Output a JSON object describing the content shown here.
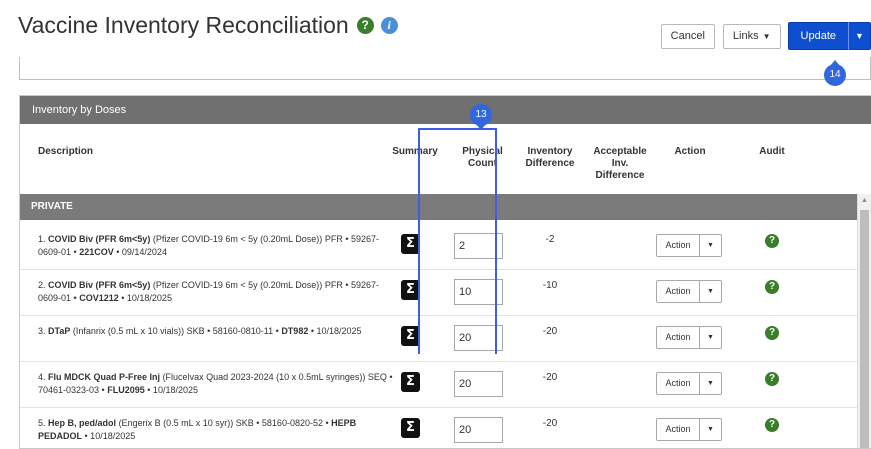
{
  "header": {
    "title": "Vaccine Inventory Reconciliation",
    "help_glyph": "?",
    "info_glyph": "i",
    "buttons": {
      "cancel": "Cancel",
      "links": "Links",
      "update": "Update"
    },
    "accent_color": "#0d4fcf"
  },
  "callouts": {
    "physical_count": "13",
    "update": "14"
  },
  "panel": {
    "title": "Inventory by Doses",
    "columns": {
      "description": "Description",
      "summary": "Summary",
      "physical_count_1": "Physical",
      "physical_count_2": "Count",
      "inventory_difference_1": "Inventory",
      "inventory_difference_2": "Difference",
      "acceptable_1": "Acceptable",
      "acceptable_2": "Inv.",
      "acceptable_3": "Difference",
      "action": "Action",
      "audit": "Audit"
    },
    "section": "PRIVATE",
    "summary_glyph": "Σ",
    "action_label": "Action",
    "audit_glyph": "?"
  },
  "rows": [
    {
      "num": "1.",
      "name": "COVID Biv (PFR 6m<5y)",
      "detail": "(Pfizer COVID-19 6m < 5y (0.20mL Dose))",
      "meta": "PFR • 59267-0609-01 •",
      "lot": "221COV",
      "date": "• 09/14/2024",
      "count": "2",
      "difference": "-2"
    },
    {
      "num": "2.",
      "name": "COVID Biv (PFR 6m<5y)",
      "detail": "(Pfizer COVID-19 6m < 5y (0.20mL Dose))",
      "meta": "PFR • 59267-0609-01 •",
      "lot": "COV1212",
      "date": "• 10/18/2025",
      "count": "10",
      "difference": "-10"
    },
    {
      "num": "3.",
      "name": "DTaP",
      "detail": "(Infanrix (0.5 mL x 10 vials)) SKB • 58160-0810-11 •",
      "meta": "",
      "lot": "DT982",
      "date": "• 10/18/2025",
      "count": "20",
      "difference": "-20"
    },
    {
      "num": "4.",
      "name": "Flu MDCK Quad P-Free Inj",
      "detail": "(Flucelvax Quad 2023-2024 (10 x 0.5mL syringes)) SEQ • 70461-0323-03 •",
      "meta": "",
      "lot": "FLU2095",
      "date": "• 10/18/2025",
      "count": "20",
      "difference": "-20"
    },
    {
      "num": "5.",
      "name": "Hep B, ped/adol",
      "detail": "(Engerix B (0.5 mL x 10 syr)) SKB • 58160-0820-52 •",
      "meta": "",
      "lot": "HEPB PEDADOL",
      "date": "• 10/18/2025",
      "count": "20",
      "difference": "-20"
    }
  ]
}
